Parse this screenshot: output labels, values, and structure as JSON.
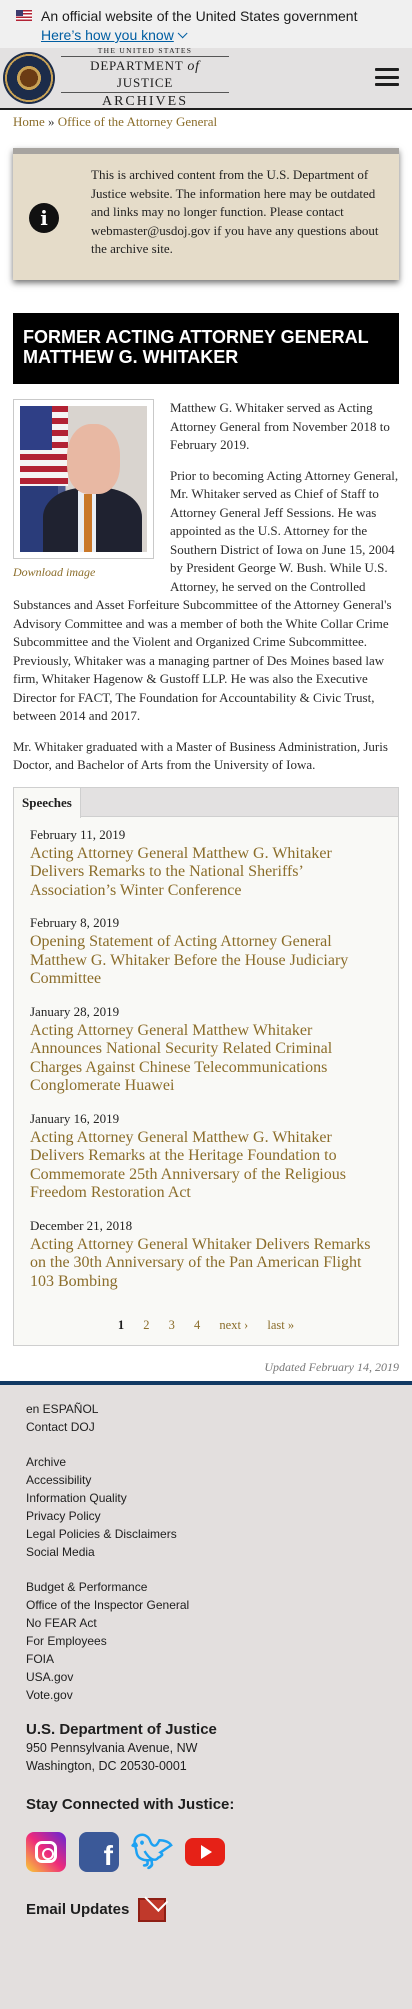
{
  "gov_banner": {
    "text": "An official website of the United States government",
    "link": "Here’s how you know"
  },
  "header": {
    "logo_line1": "THE UNITED STATES",
    "logo_line2a": "DEPARTMENT",
    "logo_line2b": "of",
    "logo_line2c": "JUSTICE",
    "logo_line3": "ARCHIVES",
    "menu_icon": "hamburger-menu-icon"
  },
  "breadcrumb": {
    "home": "Home",
    "separator": "»",
    "current": "Office of the Attorney General"
  },
  "notice": {
    "icon": "info-icon",
    "text": "This is archived content from the U.S. Department of Justice website. The information here may be outdated and links may no longer function. Please contact webmaster@usdoj.gov if you have any questions about the archive site."
  },
  "title": "Former Acting Attorney General Matthew G. Whitaker",
  "bio": {
    "download_label": "Download image",
    "paragraphs": [
      "Matthew G. Whitaker served as Acting Attorney General from November 2018 to February 2019.",
      "Prior to becoming Acting Attorney General, Mr. Whitaker served as Chief of Staff to Attorney General Jeff Sessions. He was appointed as the U.S. Attorney for the Southern District of Iowa on June 15, 2004 by President George W. Bush. While U.S. Attorney, he served on the Controlled Substances and Asset Forfeiture Subcommittee of the Attorney General's Advisory Committee and was a member of both the White Collar Crime Subcommittee and the Violent and Organized Crime Subcommittee. Previously, Whitaker was a managing partner of Des Moines based law firm, Whitaker Hagenow & Gustoff LLP. He was also the Executive Director for FACT, The Foundation for Accountability & Civic Trust, between 2014 and 2017.",
      "Mr. Whitaker graduated with a Master of Business Administration, Juris Doctor, and Bachelor of Arts from the University of Iowa."
    ]
  },
  "speeches": {
    "tab_label": "Speeches",
    "items": [
      {
        "date": "February 11, 2019",
        "title": "Acting Attorney General Matthew G. Whitaker Delivers Remarks to the National Sheriffs’ Association’s Winter Conference"
      },
      {
        "date": "February 8, 2019",
        "title": "Opening Statement of Acting Attorney General Matthew G. Whitaker Before the House Judiciary Committee"
      },
      {
        "date": "January 28, 2019",
        "title": "Acting Attorney General Matthew Whitaker Announces National Security Related Criminal Charges Against Chinese Telecommunications Conglomerate Huawei"
      },
      {
        "date": "January 16, 2019",
        "title": "Acting Attorney General Matthew G. Whitaker Delivers Remarks at the Heritage Foundation to Commemorate 25th Anniversary of the Religious Freedom Restoration Act"
      },
      {
        "date": "December 21, 2018",
        "title": "Acting Attorney General Whitaker Delivers Remarks on the 30th Anniversary of the Pan American Flight 103 Bombing"
      }
    ],
    "pager": {
      "p1": "1",
      "p2": "2",
      "p3": "3",
      "p4": "4",
      "next": "next ›",
      "last": "last »"
    }
  },
  "updated": "Updated February 14, 2019",
  "footer": {
    "group1": [
      "en ESPAÑOL",
      "Contact DOJ"
    ],
    "group2": [
      "Archive",
      "Accessibility",
      "Information Quality",
      "Privacy Policy",
      "Legal Policies & Disclaimers",
      "Social Media"
    ],
    "group3": [
      "Budget & Performance",
      "Office of the Inspector General",
      "No FEAR Act",
      "For Employees",
      "FOIA",
      "USA.gov",
      "Vote.gov"
    ],
    "org_name": "U.S. Department of Justice",
    "addr1": "950 Pennsylvania Avenue, NW",
    "addr2": "Washington, DC 20530-0001",
    "stay_connected": "Stay Connected with Justice:",
    "social_icons": [
      "instagram-icon",
      "facebook-icon",
      "twitter-icon",
      "youtube-icon"
    ],
    "email_updates": "Email Updates"
  }
}
